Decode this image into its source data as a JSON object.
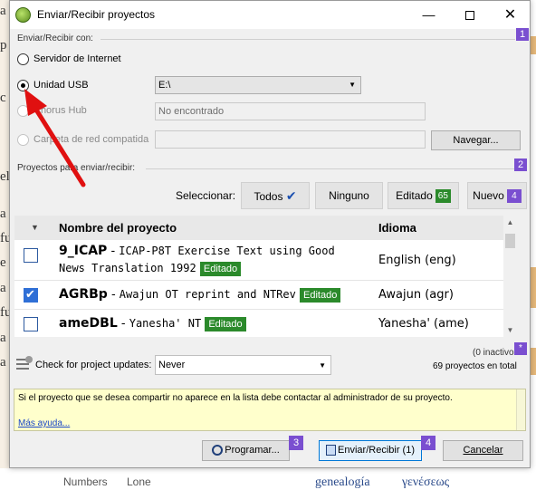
{
  "window": {
    "title": "Enviar/Recibir proyectos"
  },
  "connection": {
    "section_label": "Enviar/Recibir con:",
    "section_number": "1",
    "options": [
      {
        "label": "Servidor de Internet",
        "checked": false,
        "enabled": true
      },
      {
        "label": "Unidad USB",
        "checked": true,
        "enabled": true
      },
      {
        "label": "Chorus Hub",
        "checked": false,
        "enabled": false
      },
      {
        "label": "Carpeta de red compatida",
        "checked": false,
        "enabled": false
      }
    ],
    "usb_drive_value": "E:\\",
    "chorus_hub_value": "No encontrado",
    "network_folder_value": "",
    "browse_label": "Navegar..."
  },
  "projects": {
    "section_label": "Proyectos para enviar/recibir:",
    "section_number": "2",
    "select_label": "Seleccionar:",
    "filters": {
      "all_label": "Todos",
      "none_label": "Ninguno",
      "edited_label": "Editado",
      "edited_count": "65",
      "new_label": "Nuevo",
      "new_count": "4"
    },
    "columns": {
      "name": "Nombre del proyecto",
      "language": "Idioma"
    },
    "rows": [
      {
        "checked": false,
        "code": "9_ICAP",
        "description": "ICAP-P8T Exercise Text using Good",
        "description_line2": "News Translation 1992",
        "badge": "Editado",
        "language": "English (eng)"
      },
      {
        "checked": true,
        "code": "AGRBp",
        "description": "Awajun OT reprint and NTRev",
        "badge": "Editado",
        "language": "Awajun (agr)"
      },
      {
        "checked": false,
        "code": "ameDBL",
        "description": "Yanesha' NT",
        "badge": "Editado",
        "language": "Yanesha' (ame)"
      }
    ]
  },
  "status": {
    "update_label": "Check for project updates:",
    "update_value": "Never",
    "inactive_text": "(0 inactivo",
    "total_text": "69 proyectos en total",
    "section_marker": "*"
  },
  "info": {
    "message": "Si el proyecto que se desea compartir no aparece en la lista debe contactar al administrador de su proyecto.",
    "help_link": "Más ayuda..."
  },
  "footer": {
    "schedule_label": "Programar...",
    "schedule_number": "3",
    "send_receive_label": "Enviar/Recibir (1)",
    "send_receive_number": "4",
    "cancel_label": "Cancelar"
  },
  "background": {
    "left_letters": [
      "a",
      "p",
      "c",
      "el",
      "a",
      "fu",
      "e",
      "a",
      "fu",
      "a",
      "a"
    ],
    "bottom_cells": [
      "Numbers",
      "Lone",
      "genealogía",
      "γενέσεως"
    ]
  },
  "colors": {
    "edited_badge": "#2b8a2b",
    "new_badge": "#7a4fd0",
    "section_badge": "#7a4fd0",
    "info_background": "#ffffcc",
    "annotation_arrow": "#e01010"
  },
  "icons": [
    "app-logo-icon",
    "minimize-icon",
    "maximize-icon",
    "close-icon",
    "checkmark-icon",
    "sort-arrow-icon",
    "update-settings-icon",
    "clock-icon",
    "send-receive-icon"
  ]
}
